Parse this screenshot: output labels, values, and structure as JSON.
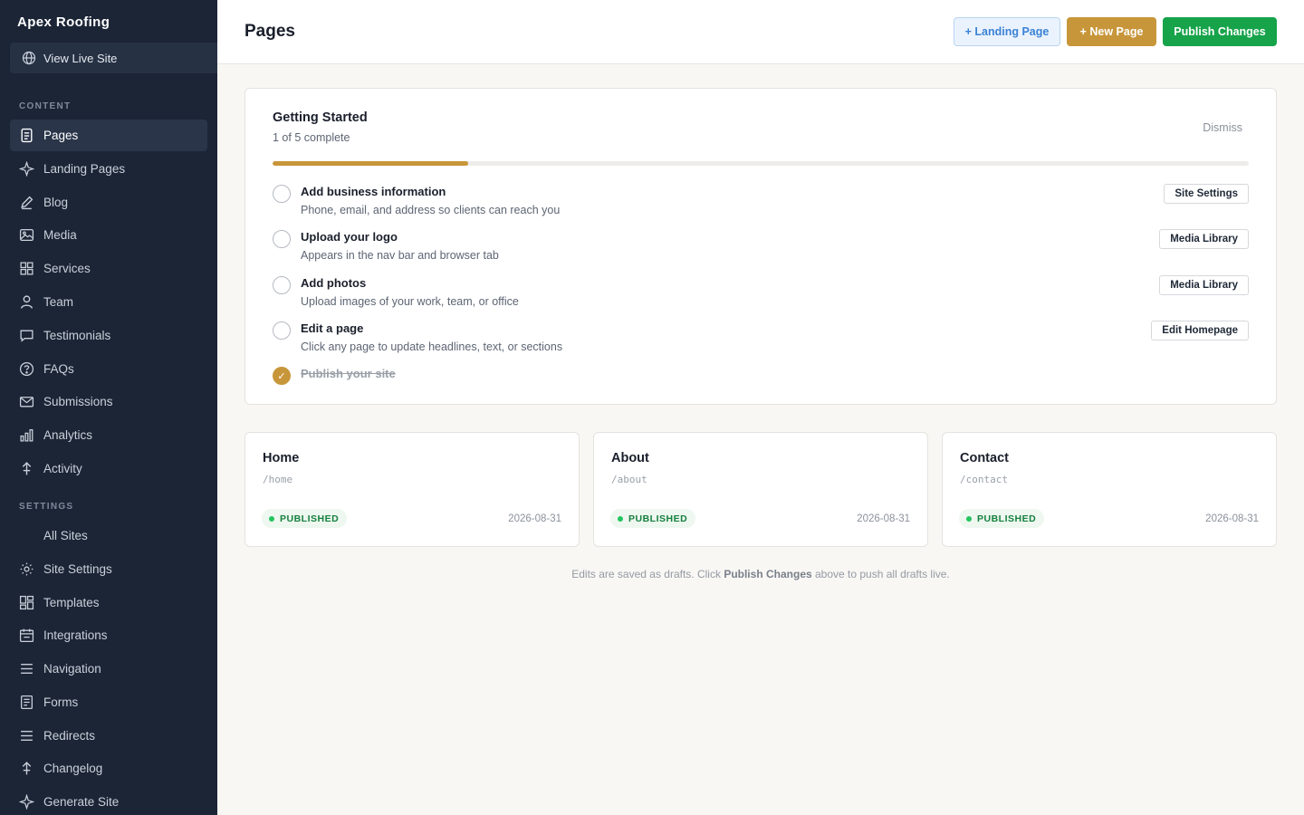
{
  "sidebar": {
    "brand": "Apex Roofing",
    "live_site_label": "View Live Site",
    "content_label": "CONTENT",
    "settings_label": "SETTINGS",
    "content_items": [
      {
        "label": "Pages",
        "icon": "document-icon",
        "active": true
      },
      {
        "label": "Landing Pages",
        "icon": "sparkle-icon"
      },
      {
        "label": "Blog",
        "icon": "pencil-icon"
      },
      {
        "label": "Media",
        "icon": "image-icon"
      },
      {
        "label": "Services",
        "icon": "grid-icon"
      },
      {
        "label": "Team",
        "icon": "person-icon"
      },
      {
        "label": "Testimonials",
        "icon": "chat-bubble-icon"
      },
      {
        "label": "FAQs",
        "icon": "question-circle-icon"
      },
      {
        "label": "Submissions",
        "icon": "envelope-icon"
      },
      {
        "label": "Analytics",
        "icon": "bar-chart-icon"
      },
      {
        "label": "Activity",
        "icon": "anchor-icon"
      }
    ],
    "settings_items": [
      {
        "label": "All Sites",
        "icon": ""
      },
      {
        "label": "Site Settings",
        "icon": "sun-gear-icon"
      },
      {
        "label": "Templates",
        "icon": "layout-icon"
      },
      {
        "label": "Integrations",
        "icon": "calendar-icon"
      },
      {
        "label": "Navigation",
        "icon": "menu-lines-icon"
      },
      {
        "label": "Forms",
        "icon": "form-icon"
      },
      {
        "label": "Redirects",
        "icon": "menu-lines-icon"
      },
      {
        "label": "Changelog",
        "icon": "anchor-icon"
      },
      {
        "label": "Generate Site",
        "icon": "sparkle-icon"
      }
    ]
  },
  "header": {
    "title": "Pages",
    "landing_button": "+ Landing Page",
    "new_button": "+ New Page",
    "publish_button": "Publish Changes"
  },
  "getting_started": {
    "title": "Getting Started",
    "subtitle": "1 of 5 complete",
    "dismiss": "Dismiss",
    "progress_fraction": 0.2,
    "tasks": [
      {
        "title": "Add business information",
        "desc": "Phone, email, and address so clients can reach you",
        "button": "Site Settings",
        "done": false
      },
      {
        "title": "Upload your logo",
        "desc": "Appears in the nav bar and browser tab",
        "button": "Media Library",
        "done": false
      },
      {
        "title": "Add photos",
        "desc": "Upload images of your work, team, or office",
        "button": "Media Library",
        "done": false
      },
      {
        "title": "Edit a page",
        "desc": "Click any page to update headlines, text, or sections",
        "button": "Edit Homepage",
        "done": false
      },
      {
        "title": "Publish your site",
        "desc": "",
        "button": "",
        "done": true
      }
    ],
    "done_mark": "✓"
  },
  "pages": [
    {
      "name": "Home",
      "slug": "/home",
      "status": "PUBLISHED",
      "date": "2026-08-31"
    },
    {
      "name": "About",
      "slug": "/about",
      "status": "PUBLISHED",
      "date": "2026-08-31"
    },
    {
      "name": "Contact",
      "slug": "/contact",
      "status": "PUBLISHED",
      "date": "2026-08-31"
    }
  ],
  "footnote": {
    "before": "Edits are saved as drafts. Click ",
    "bold": "Publish Changes",
    "after": " above to push all drafts live."
  },
  "colors": {
    "sidebar_bg": "#1c2536",
    "accent_gold": "#c8963a",
    "publish_green": "#16a34a",
    "landing_blue": "#3b82d6"
  }
}
